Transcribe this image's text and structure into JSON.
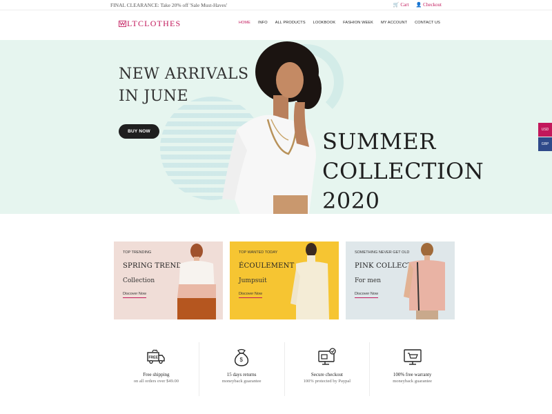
{
  "topbar": {
    "promo": "FINAL CLEARANCE: Take 20% off 'Sale Must-Haves'",
    "cart_label": "Cart",
    "checkout_label": "Checkout"
  },
  "header": {
    "logo": "LTCLOTHES",
    "nav": [
      "HOME",
      "INFO",
      "ALL PRODUCTS",
      "LOOKBOOK",
      "FASHION WEEK",
      "MY ACCOUNT",
      "CONTACT US"
    ],
    "active_nav": "HOME"
  },
  "hero": {
    "headline_line1": "NEW ARRIVALS",
    "headline_line2": "IN JUNE",
    "button": "BUY NOW",
    "big_line1": "SUMMER",
    "big_line2": "COLLECTION",
    "big_line3": "2020"
  },
  "currency": [
    "USD",
    "GBP"
  ],
  "cards": [
    {
      "kicker": "TOP TRENDING",
      "title": "SPRING TRENDS",
      "sub": "Collection",
      "link": "Discover Now"
    },
    {
      "kicker": "TOP WANTED TODAY",
      "title": "ÉCOULEMENT",
      "sub": "Jumpsuit",
      "link": "Discover Now"
    },
    {
      "kicker": "SOMETHING NEVER GET OLD",
      "title": "PINK COLLECTION",
      "sub": "For men",
      "link": "Discover Now"
    }
  ],
  "features": [
    {
      "icon": "truck-icon",
      "title": "Free shipping",
      "sub": "on all orders over $49.00",
      "badge": "FREE"
    },
    {
      "icon": "money-bag-icon",
      "title": "15 days returns",
      "sub": "moneyback guarantee"
    },
    {
      "icon": "secure-checkout-icon",
      "title": "Secure checkout",
      "sub": "100% protected by Paypal"
    },
    {
      "icon": "cart-warranty-icon",
      "title": "100% free warranty",
      "sub": "moneyback guarantee"
    }
  ],
  "colors": {
    "accent": "#c2185b",
    "hero_bg": "#e6f5ef",
    "card1_bg": "#f0ddd7",
    "card2_bg": "#f6c532",
    "card3_bg": "#dfe7ea",
    "gbp_bg": "#2f4a8a"
  }
}
